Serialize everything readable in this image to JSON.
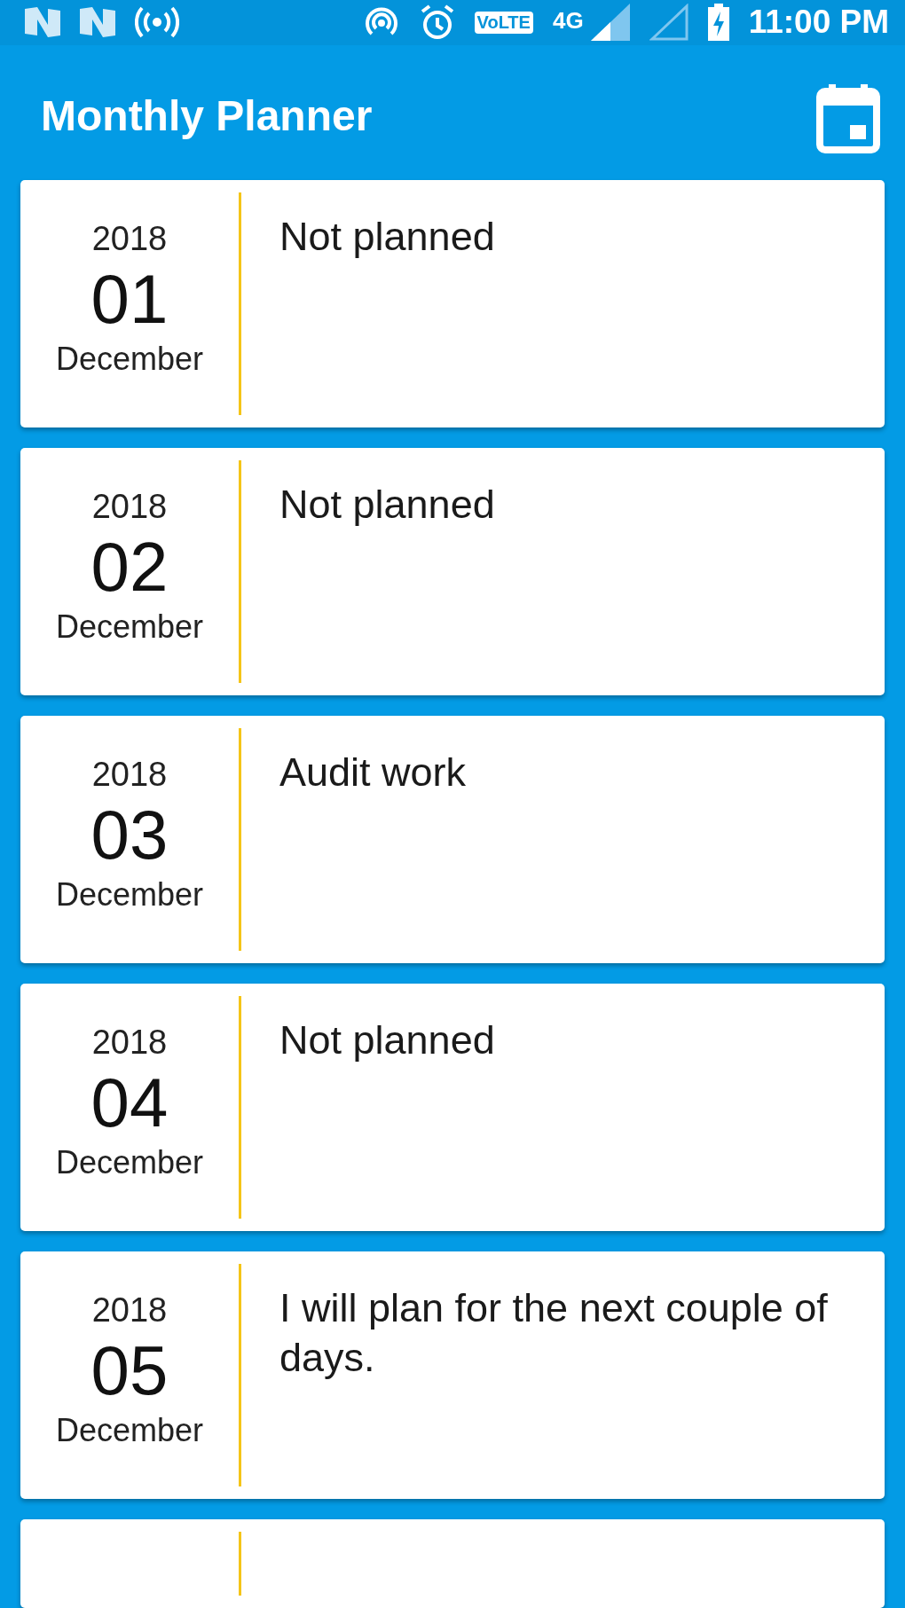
{
  "status_bar": {
    "time": "11:00 PM",
    "network": "4G",
    "volte": "VoLTE"
  },
  "app_bar": {
    "title": "Monthly Planner"
  },
  "days": [
    {
      "year": "2018",
      "day": "01",
      "month": "December",
      "plan": "Not planned"
    },
    {
      "year": "2018",
      "day": "02",
      "month": "December",
      "plan": "Not planned"
    },
    {
      "year": "2018",
      "day": "03",
      "month": "December",
      "plan": "Audit work"
    },
    {
      "year": "2018",
      "day": "04",
      "month": "December",
      "plan": "Not planned"
    },
    {
      "year": "2018",
      "day": "05",
      "month": "December",
      "plan": "I will plan for the next couple of days."
    }
  ]
}
